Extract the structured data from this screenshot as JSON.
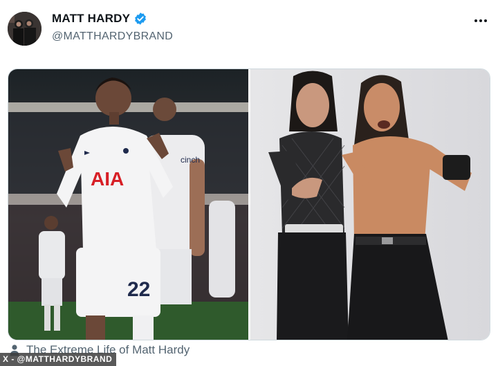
{
  "author": {
    "name": "MATT HARDY",
    "handle": "@MATTHARDYBRAND",
    "verified": true
  },
  "icons": {
    "verified": "verified-badge-icon",
    "more": "more-options-icon",
    "community": "person-icon"
  },
  "media": {
    "left_photo": {
      "jersey_sponsor": "AIA",
      "jersey_number": "22",
      "board_text": "cinch"
    },
    "right_photo": {}
  },
  "footer": {
    "community_label": "The Extreme Life of Matt Hardy"
  },
  "credit": "X - @MATTHARDYBRAND",
  "colors": {
    "verified_blue": "#1d9bf0",
    "name_text": "#0f1419",
    "secondary_text": "#536471"
  }
}
